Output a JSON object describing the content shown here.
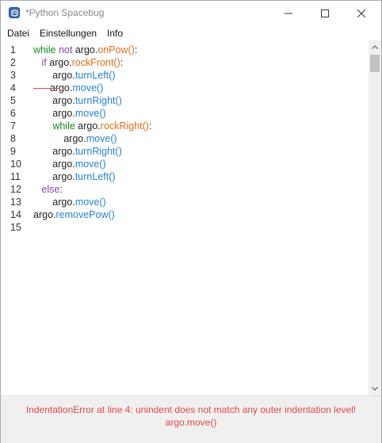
{
  "window": {
    "title": "*Python Spacebug"
  },
  "menu": {
    "items": [
      "Datei",
      "Einstellungen",
      "Info"
    ]
  },
  "editor": {
    "line_numbers": [
      "1",
      "2",
      "3",
      "4",
      "5",
      "6",
      "7",
      "8",
      "9",
      "10",
      "11",
      "12",
      "13",
      "14",
      "15"
    ],
    "lines": [
      [
        {
          "t": "while",
          "c": "kw"
        },
        {
          "t": " ",
          "c": ""
        },
        {
          "t": "not",
          "c": "kw-purple"
        },
        {
          "t": " argo.",
          "c": ""
        },
        {
          "t": "onPow()",
          "c": "fn-orange"
        },
        {
          "t": ":",
          "c": ""
        }
      ],
      [
        {
          "t": "   ",
          "c": ""
        },
        {
          "t": "if",
          "c": "kw-purple"
        },
        {
          "t": " argo.",
          "c": ""
        },
        {
          "t": "rockFront()",
          "c": "fn-orange"
        },
        {
          "t": ":",
          "c": ""
        }
      ],
      [
        {
          "t": "       argo.",
          "c": ""
        },
        {
          "t": "turnLeft()",
          "c": "fn-blue"
        }
      ],
      [
        {
          "t": "      argo.",
          "c": ""
        },
        {
          "t": "move()",
          "c": "fn-blue"
        }
      ],
      [
        {
          "t": "       argo.",
          "c": ""
        },
        {
          "t": "turnRight()",
          "c": "fn-blue"
        }
      ],
      [
        {
          "t": "       argo.",
          "c": ""
        },
        {
          "t": "move()",
          "c": "fn-blue"
        }
      ],
      [
        {
          "t": "       ",
          "c": ""
        },
        {
          "t": "while",
          "c": "kw"
        },
        {
          "t": " argo.",
          "c": ""
        },
        {
          "t": "rockRight()",
          "c": "fn-orange"
        },
        {
          "t": ":",
          "c": ""
        }
      ],
      [
        {
          "t": "           argo.",
          "c": ""
        },
        {
          "t": "move()",
          "c": "fn-blue"
        }
      ],
      [
        {
          "t": "       argo.",
          "c": ""
        },
        {
          "t": "turnRight()",
          "c": "fn-blue"
        }
      ],
      [
        {
          "t": "       argo.",
          "c": ""
        },
        {
          "t": "move()",
          "c": "fn-blue"
        }
      ],
      [
        {
          "t": "       argo.",
          "c": ""
        },
        {
          "t": "turnLeft()",
          "c": "fn-blue"
        }
      ],
      [
        {
          "t": "   ",
          "c": ""
        },
        {
          "t": "else",
          "c": "kw-purple"
        },
        {
          "t": ":",
          "c": ""
        }
      ],
      [
        {
          "t": "       argo.",
          "c": ""
        },
        {
          "t": "move()",
          "c": "fn-blue"
        }
      ],
      [
        {
          "t": "argo.",
          "c": ""
        },
        {
          "t": "removePow()",
          "c": "fn-blue"
        }
      ],
      []
    ]
  },
  "status": {
    "line1": "IndentationError at line 4: unindent does not match any outer indentation level!",
    "line2": "argo.move()"
  },
  "icons": {
    "app": "spacebug-app-icon",
    "minimize": "minimize-icon",
    "maximize": "maximize-icon",
    "close": "close-icon",
    "scroll_up": "chevron-up-icon",
    "scroll_down": "chevron-down-icon"
  }
}
